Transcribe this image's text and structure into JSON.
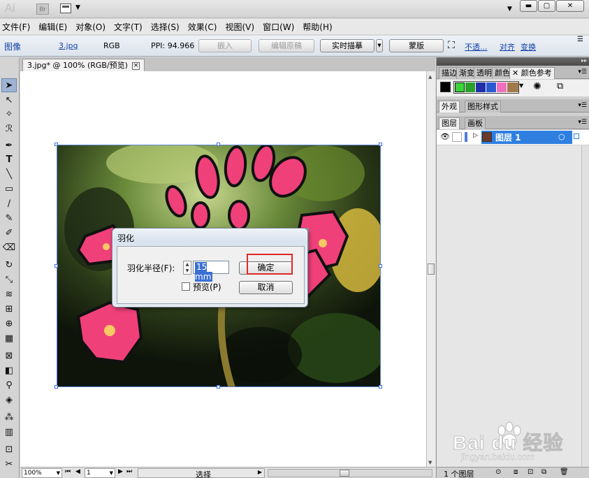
{
  "app": {
    "logo": "Ai",
    "bridge_label": "Br"
  },
  "menubar": {
    "items": [
      "文件(F)",
      "编辑(E)",
      "对象(O)",
      "文字(T)",
      "选择(S)",
      "效果(C)",
      "视图(V)",
      "窗口(W)",
      "帮助(H)"
    ]
  },
  "controlbar": {
    "object_type": "图像",
    "file_name": "3.jpg",
    "color_mode": "RGB",
    "ppi": "PPI: 94.966",
    "embed": "嵌入",
    "edit_original": "编辑原稿",
    "live_trace": "实时描摹",
    "mask": "蒙版",
    "opacity": "不透...",
    "align": "对齐",
    "transform": "变换"
  },
  "document": {
    "tab_title": "3.jpg* @ 100% (RGB/预览)"
  },
  "dialog": {
    "title": "羽化",
    "radius_label": "羽化半径(F):",
    "radius_value": "15 mm",
    "preview_label": "预览(P)",
    "preview_checked": false,
    "ok_label": "确定",
    "cancel_label": "取消"
  },
  "panels": {
    "top_tabs": [
      "描边",
      "渐变",
      "透明",
      "颜色",
      "颜色参考"
    ],
    "mid_tabs": [
      "外观",
      "图形样式"
    ],
    "layer_tabs": [
      "图层",
      "画板"
    ],
    "layer_name": "图层 1",
    "layer_count": "1 个图层",
    "swatch_colors": [
      "#3ad43a",
      "#2aa02a",
      "#222ea8",
      "#2a5ad0",
      "#f070c0",
      "#a07a4a"
    ]
  },
  "statusbar": {
    "zoom": "100%",
    "artboard": "1",
    "mode": "选择"
  },
  "watermark": {
    "brand": "Bai du 经验",
    "url": "jingyan.baidu.com"
  }
}
